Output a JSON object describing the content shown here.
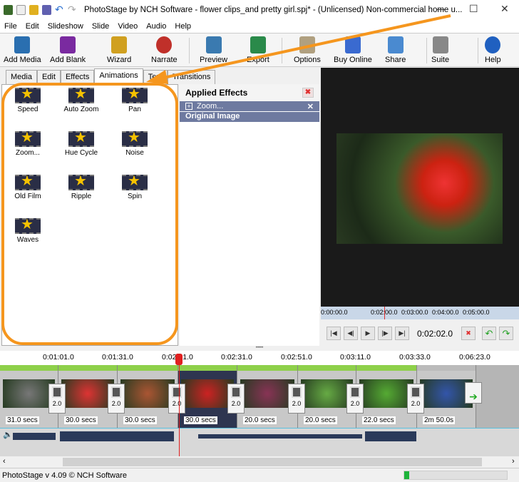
{
  "window": {
    "title": "PhotoStage by NCH Software - flower clips_and pretty girl.spj* - (Unlicensed) Non-commercial home u...",
    "minimize": "—",
    "maximize": "☐",
    "close": "✕"
  },
  "menu": [
    "File",
    "Edit",
    "Slideshow",
    "Slide",
    "Video",
    "Audio",
    "Help"
  ],
  "toolbar": [
    {
      "label": "Add Media",
      "color": "#2a6fb0"
    },
    {
      "label": "Add Blank",
      "color": "#7a2aa0"
    },
    {
      "label": "Wizard",
      "color": "#d0a020"
    },
    {
      "label": "Narrate",
      "color": "#c0302a"
    },
    {
      "label": "Preview",
      "color": "#3a7ab0"
    },
    {
      "label": "Export",
      "color": "#2a8a4a"
    },
    {
      "label": "Options",
      "color": "#b0a080"
    },
    {
      "label": "Buy Online",
      "color": "#3a6ad0"
    },
    {
      "label": "Share",
      "color": "#4a8ad0"
    },
    {
      "label": "Suite",
      "color": "#888888"
    },
    {
      "label": "Help",
      "color": "#2060c0"
    }
  ],
  "tabs": [
    {
      "label": "Media"
    },
    {
      "label": "Edit"
    },
    {
      "label": "Effects"
    },
    {
      "label": "Animations",
      "active": true
    },
    {
      "label": "Text"
    },
    {
      "label": "Transitions"
    }
  ],
  "animations": [
    "Speed",
    "Auto Zoom",
    "Pan",
    "Zoom...",
    "Hue Cycle",
    "Noise",
    "Old Film",
    "Ripple",
    "Spin",
    "Waves"
  ],
  "applied_effects": {
    "title": "Applied Effects",
    "items": [
      "Zoom..."
    ],
    "original": "Original Image"
  },
  "preview": {
    "ruler": [
      "0:00:00.0",
      "0:02:00.0",
      "0:03:00.0",
      "0:04:00.0",
      "0:05:00.0"
    ],
    "time": "0:02:02.0"
  },
  "timeline": {
    "ruler": [
      "0:01:01.0",
      "0:01:31.0",
      "0:02:01.0",
      "0:02:31.0",
      "0:02:51.0",
      "0:03:11.0",
      "0:03:33.0",
      "0:06:23.0"
    ],
    "clips": [
      "31.0 secs",
      "30.0 secs",
      "30.0 secs",
      "30.0 secs",
      "20.0 secs",
      "20.0 secs",
      "22.0 secs",
      "2m 50.0s"
    ],
    "transitions": [
      "2.0",
      "2.0",
      "2.0",
      "2.0",
      "2.0",
      "2.0",
      "2.0"
    ]
  },
  "status": {
    "text": "PhotoStage v 4.09 © NCH Software",
    "progress": 0.05
  },
  "annotation_color": "#f5961e"
}
